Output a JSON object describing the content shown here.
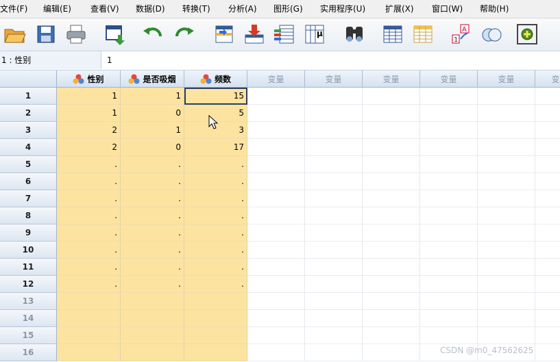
{
  "menu": [
    {
      "label": "文件(F)",
      "name": "menu-file"
    },
    {
      "label": "编辑(E)",
      "name": "menu-edit"
    },
    {
      "label": "查看(V)",
      "name": "menu-view"
    },
    {
      "label": "数据(D)",
      "name": "menu-data"
    },
    {
      "label": "转换(T)",
      "name": "menu-transform"
    },
    {
      "label": "分析(A)",
      "name": "menu-analyze"
    },
    {
      "label": "图形(G)",
      "name": "menu-graphs"
    },
    {
      "label": "实用程序(U)",
      "name": "menu-utilities"
    },
    {
      "label": "扩展(X)",
      "name": "menu-extensions"
    },
    {
      "label": "窗口(W)",
      "name": "menu-window"
    },
    {
      "label": "帮助(H)",
      "name": "menu-help"
    }
  ],
  "toolbar": [
    "open-folder-icon",
    "save-icon",
    "print-icon",
    "dialog-recall-icon",
    "undo-icon",
    "redo-icon",
    "goto-case-icon",
    "goto-variable-icon",
    "variables-icon",
    "descriptive-stats-icon",
    "find-icon",
    "insert-cases-icon",
    "insert-variable-icon",
    "weight-cases-icon",
    "value-labels-icon",
    "use-variable-sets-icon"
  ],
  "cell_editor": {
    "reference": "1 : 性别",
    "value": "1"
  },
  "columns": [
    {
      "label": "性别",
      "is_variable": true
    },
    {
      "label": "是否吸烟",
      "is_variable": true
    },
    {
      "label": "频数",
      "is_variable": true
    },
    {
      "label": "变量",
      "is_variable": false
    },
    {
      "label": "变量",
      "is_variable": false
    },
    {
      "label": "变量",
      "is_variable": false
    },
    {
      "label": "变量",
      "is_variable": false
    },
    {
      "label": "变量",
      "is_variable": false
    },
    {
      "label": "变",
      "is_variable": false
    }
  ],
  "rows": [
    {
      "num": "1",
      "values": [
        "1",
        "1",
        "15"
      ]
    },
    {
      "num": "2",
      "values": [
        "1",
        "0",
        "5"
      ]
    },
    {
      "num": "3",
      "values": [
        "2",
        "1",
        "3"
      ]
    },
    {
      "num": "4",
      "values": [
        "2",
        "0",
        "17"
      ]
    },
    {
      "num": "5",
      "values": [
        ".",
        ".",
        "."
      ]
    },
    {
      "num": "6",
      "values": [
        ".",
        ".",
        "."
      ]
    },
    {
      "num": "7",
      "values": [
        ".",
        ".",
        "."
      ]
    },
    {
      "num": "8",
      "values": [
        ".",
        ".",
        "."
      ]
    },
    {
      "num": "9",
      "values": [
        ".",
        ".",
        "."
      ]
    },
    {
      "num": "10",
      "values": [
        ".",
        ".",
        "."
      ]
    },
    {
      "num": "11",
      "values": [
        ".",
        ".",
        "."
      ]
    },
    {
      "num": "12",
      "values": [
        ".",
        ".",
        "."
      ]
    },
    {
      "num": "13",
      "values": [
        "",
        "",
        ""
      ]
    },
    {
      "num": "14",
      "values": [
        "",
        "",
        ""
      ]
    },
    {
      "num": "15",
      "values": [
        "",
        "",
        ""
      ]
    },
    {
      "num": "16",
      "values": [
        "",
        "",
        ""
      ]
    }
  ],
  "selected_cell": {
    "row": 1,
    "column": "频数"
  },
  "colors": {
    "data_cell": "#fde3a0",
    "header": "#dbe6f3",
    "selection_border": "#2b3f5c"
  },
  "watermark": "CSDN @m0_47562625"
}
